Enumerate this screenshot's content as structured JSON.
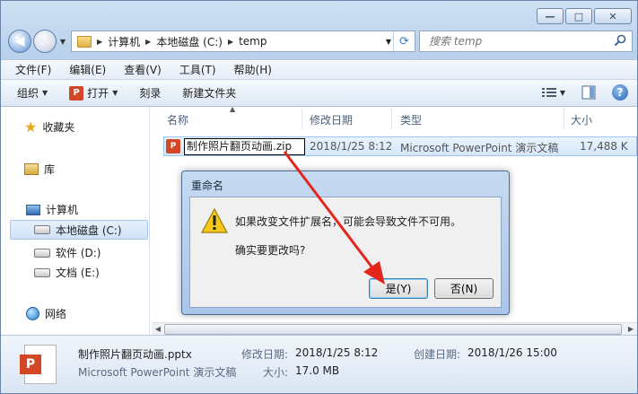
{
  "window": {
    "caption_minimize": "—",
    "caption_maximize": "□",
    "caption_close": "✕"
  },
  "address": {
    "crumbs": [
      "计算机",
      "本地磁盘 (C:)",
      "temp"
    ]
  },
  "search": {
    "placeholder": "搜索 temp"
  },
  "menu": [
    "文件(F)",
    "编辑(E)",
    "查看(V)",
    "工具(T)",
    "帮助(H)"
  ],
  "toolbar": {
    "organize": "组织",
    "open": "打开",
    "burn": "刻录",
    "new_folder": "新建文件夹",
    "help": "?"
  },
  "navpane": {
    "favorites": "收藏夹",
    "libraries": "库",
    "computer": "计算机",
    "drive_c": "本地磁盘 (C:)",
    "drive_d": "软件 (D:)",
    "drive_e": "文档 (E:)",
    "network": "网络"
  },
  "columns": {
    "name": "名称",
    "modified": "修改日期",
    "type": "类型",
    "size": "大小"
  },
  "file": {
    "rename_value": "制作照片翻页动画.zip",
    "modified": "2018/1/25 8:12",
    "type": "Microsoft PowerPoint 演示文稿",
    "size": "17,488 K"
  },
  "details": {
    "filename": "制作照片翻页动画.pptx",
    "filetype": "Microsoft PowerPoint 演示文稿",
    "modified_label": "修改日期:",
    "modified_value": "2018/1/25 8:12",
    "created_label": "创建日期:",
    "created_value": "2018/1/26 15:00",
    "size_label": "大小:",
    "size_value": "17.0 MB"
  },
  "dialog": {
    "title": "重命名",
    "message": "如果改变文件扩展名，可能会导致文件不可用。",
    "question": "确实要更改吗?",
    "yes": "是(Y)",
    "no": "否(N)"
  },
  "colors": {
    "accent": "#3c7fb1",
    "annotation_arrow": "#e3261c",
    "ppt_orange": "#d24726"
  }
}
